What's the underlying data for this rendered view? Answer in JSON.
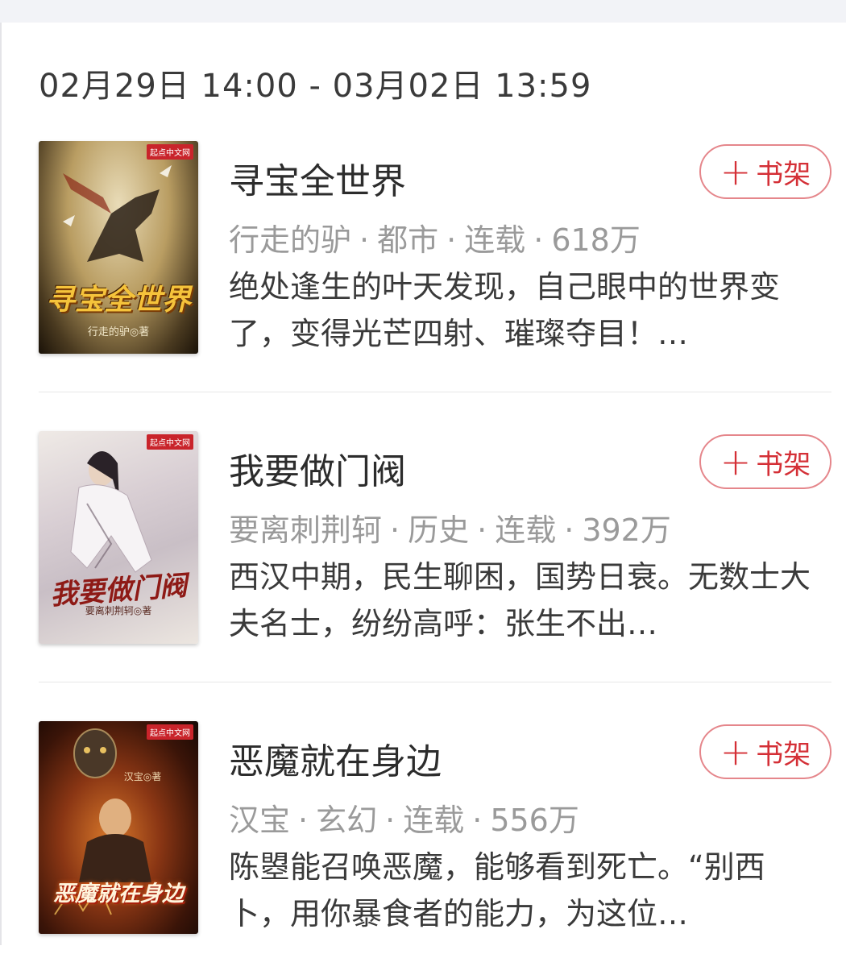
{
  "date_range": "02月29日 14:00 - 03月02日 13:59",
  "shelf_label": "书架",
  "meta_separator": "·",
  "books": [
    {
      "title": "寻宝全世界",
      "author": "行走的驴",
      "genre": "都市",
      "status": "连载",
      "words": "618万",
      "description": "绝处逢生的叶天发现，自己眼中的世界变了，变得光芒四射、璀璨夺目！…",
      "cover": {
        "title_text": "寻宝全世界",
        "author_text": "行走的驴◎著",
        "badge_text": "起点中文网"
      }
    },
    {
      "title": "我要做门阀",
      "author": "要离刺荆轲",
      "genre": "历史",
      "status": "连载",
      "words": "392万",
      "description": "西汉中期，民生聊困，国势日衰。无数士大夫名士，纷纷高呼：张生不出…",
      "cover": {
        "title_text": "我要做门阀",
        "author_text": "要离刺荆轲◎著",
        "badge_text": "起点中文网"
      }
    },
    {
      "title": "恶魔就在身边",
      "author": "汉宝",
      "genre": "玄幻",
      "status": "连载",
      "words": "556万",
      "description": "陈曌能召唤恶魔，能够看到死亡。“别西卜，用你暴食者的能力，为这位…",
      "cover": {
        "title_text": "恶魔就在身边",
        "author_text": "汉宝◎著",
        "badge_text": "起点中文网"
      }
    }
  ]
}
